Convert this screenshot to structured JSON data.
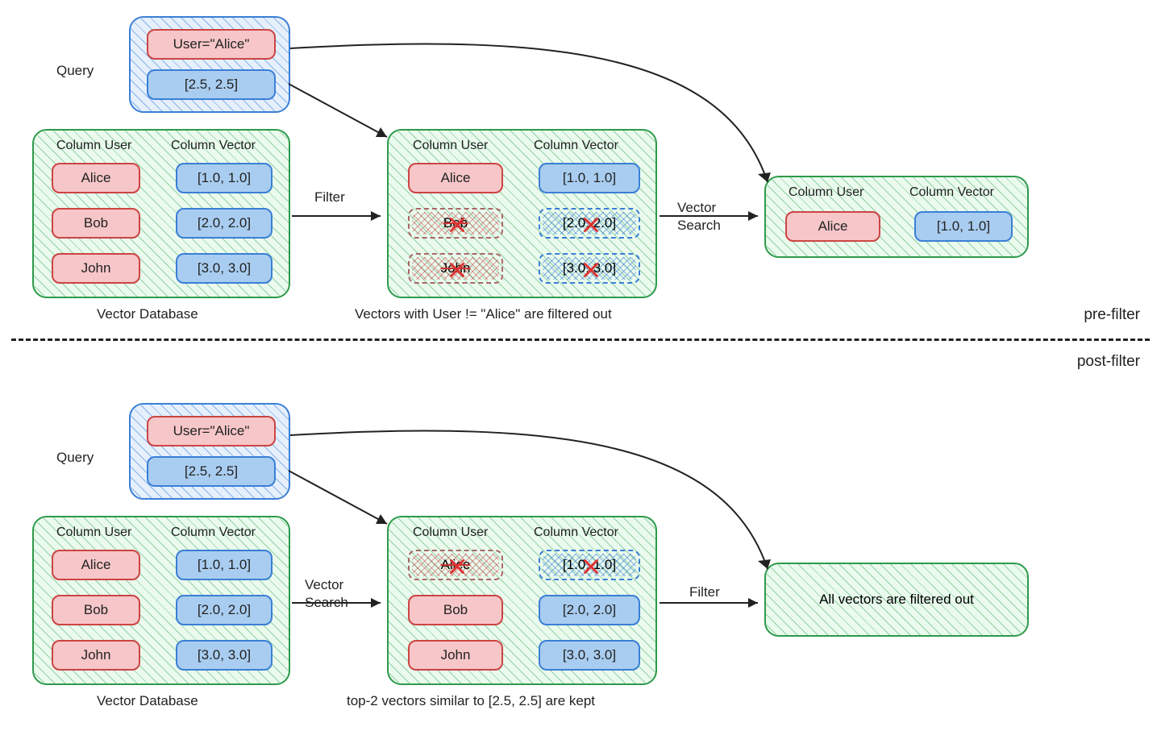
{
  "sections": {
    "pre": "pre-filter",
    "post": "post-filter"
  },
  "labels": {
    "query": "Query",
    "filter": "Filter",
    "vector_search_1": "Vector",
    "vector_search_2": "Search",
    "vector_database": "Vector Database",
    "column_user": "Column User",
    "column_vector": "Column Vector"
  },
  "query": {
    "user_eq": "User=\"Alice\"",
    "vector": "[2.5, 2.5]"
  },
  "db": {
    "rows": [
      {
        "user": "Alice",
        "vec": "[1.0, 1.0]"
      },
      {
        "user": "Bob",
        "vec": "[2.0, 2.0]"
      },
      {
        "user": "John",
        "vec": "[3.0, 3.0]"
      }
    ]
  },
  "pre": {
    "caption": "Vectors with User != \"Alice\" are filtered out",
    "filtered": {
      "rows": [
        {
          "user": "Alice",
          "vec": "[1.0, 1.0]",
          "kept": true
        },
        {
          "user": "Bob",
          "vec": "[2.0, 2.0]",
          "kept": false
        },
        {
          "user": "John",
          "vec": "[3.0, 3.0]",
          "kept": false
        }
      ]
    },
    "result": {
      "user": "Alice",
      "vec": "[1.0, 1.0]"
    }
  },
  "post": {
    "caption": "top-2 vectors similar to [2.5, 2.5] are kept",
    "filtered": {
      "rows": [
        {
          "user": "Alice",
          "vec": "[1.0, 1.0]",
          "kept": false
        },
        {
          "user": "Bob",
          "vec": "[2.0, 2.0]",
          "kept": true
        },
        {
          "user": "John",
          "vec": "[3.0, 3.0]",
          "kept": true
        }
      ]
    },
    "result_text": "All vectors are filtered out"
  }
}
